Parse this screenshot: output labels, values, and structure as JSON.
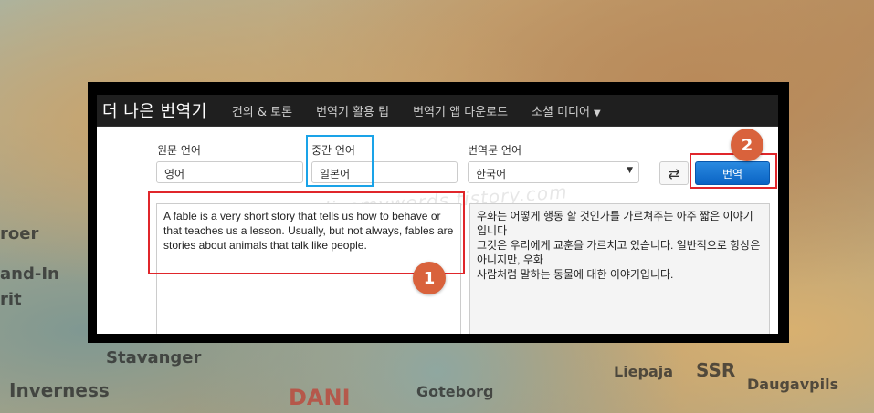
{
  "brand": "더 나은 번역기",
  "nav": {
    "items": [
      "건의 & 토론",
      "번역기 활용 팁",
      "번역기 앱 다운로드"
    ],
    "social": "소셜 미디어"
  },
  "form": {
    "source_label": "원문 언어",
    "source_value": "영어",
    "middle_label": "중간 언어",
    "middle_value": "일본어",
    "target_label": "번역문 언어",
    "target_value": "한국어",
    "translate_button": "번역"
  },
  "source_text": "A fable is a very short story that tells us how to behave or that teaches us a lesson. Usually, but not always, fables are stories about animals that talk like people.",
  "output_text": "우화는 어떻게 행동 할 것인가를 가르쳐주는 아주 짧은 이야기입니다\n그것은 우리에게 교훈을 가르치고 있습니다. 일반적으로 항상은 아니지만, 우화\n사람처럼 말하는 동물에 대한 이야기입니다.",
  "watermark": "alicemywords.tistory.com",
  "annotations": {
    "badge1": "1",
    "badge2": "2"
  },
  "map_labels": [
    "Stavanger",
    "Inverness",
    "DANI",
    "Goteborg",
    "Liepaja",
    "SSR",
    "Daugavpils",
    "roer",
    "and-In",
    "rit"
  ],
  "colors": {
    "highlight_red": "#e0262b",
    "highlight_blue": "#1aa3e8",
    "badge": "#d9623c",
    "translate_button": "#0a63c4"
  }
}
